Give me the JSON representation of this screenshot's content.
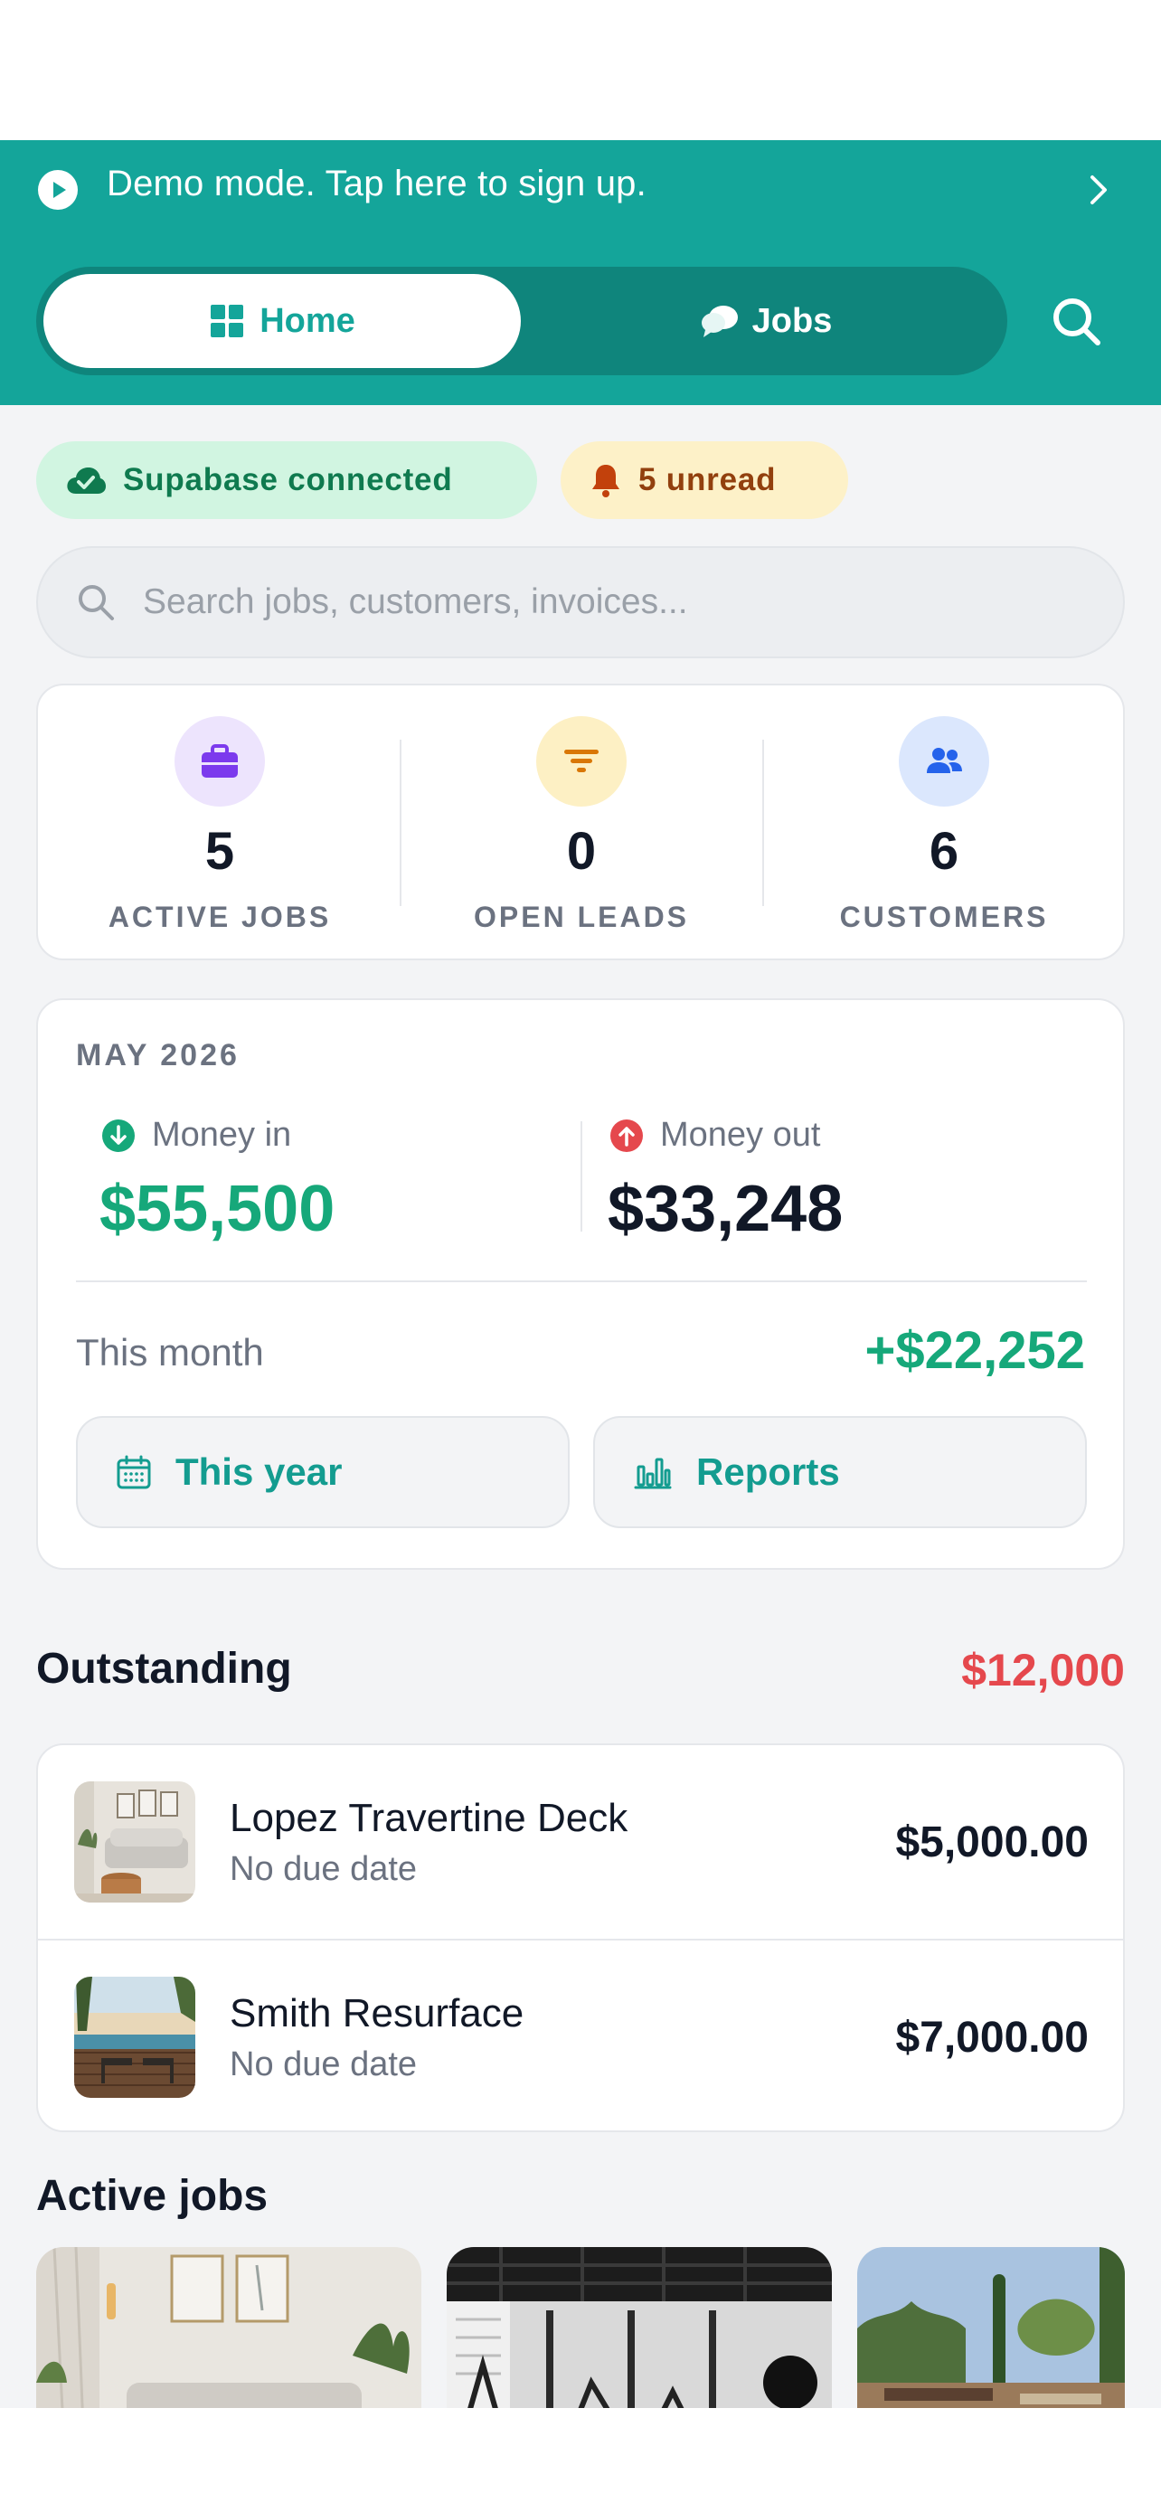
{
  "banner": {
    "text": "Demo mode. Tap here to sign up."
  },
  "nav": {
    "home_label": "Home",
    "jobs_label": "Jobs"
  },
  "status": {
    "connection": "Supabase connected",
    "unread": "5 unread"
  },
  "search": {
    "placeholder": "Search jobs, customers, invoices..."
  },
  "stats": [
    {
      "value": "5",
      "label": "ACTIVE JOBS",
      "icon": "briefcase-icon"
    },
    {
      "value": "0",
      "label": "OPEN LEADS",
      "icon": "filter-icon"
    },
    {
      "value": "6",
      "label": "CUSTOMERS",
      "icon": "users-icon"
    }
  ],
  "money": {
    "period": "MAY 2026",
    "in_label": "Money in",
    "in_value": "$55,500",
    "out_label": "Money out",
    "out_value": "$33,248",
    "net_label": "This month",
    "net_value": "+$22,252",
    "year_button": "This year",
    "reports_button": "Reports"
  },
  "outstanding": {
    "title": "Outstanding",
    "total": "$12,000",
    "items": [
      {
        "name": "Lopez Travertine Deck",
        "due": "No due date",
        "amount": "$5,000.00"
      },
      {
        "name": "Smith Resurface",
        "due": "No due date",
        "amount": "$7,000.00"
      }
    ]
  },
  "active_jobs": {
    "title": "Active jobs"
  },
  "colors": {
    "brand": "#14a59a",
    "brand_dark": "#0f857c",
    "positive": "#16a87a",
    "negative": "#e5484d"
  }
}
